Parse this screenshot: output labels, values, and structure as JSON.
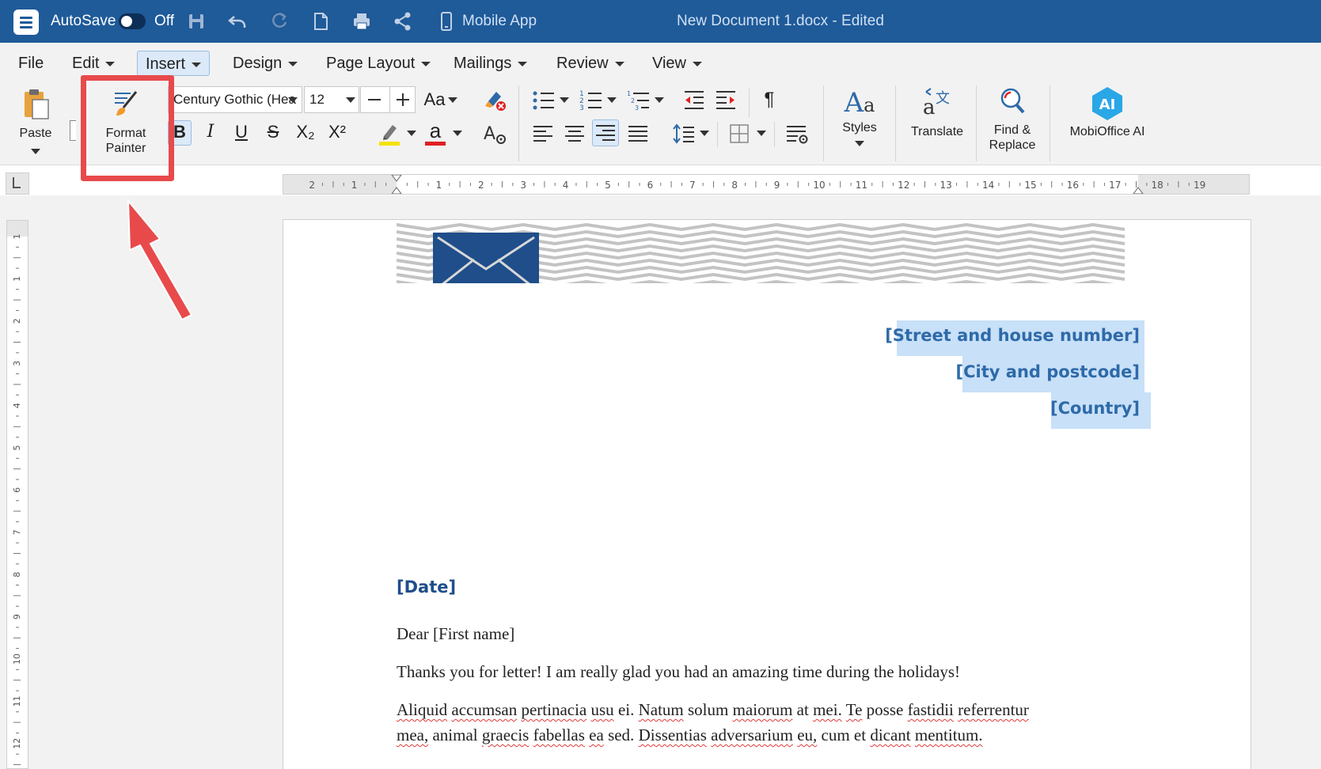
{
  "titlebar": {
    "autosave_label": "AutoSave",
    "autosave_state": "Off",
    "mobile_app_label": "Mobile App",
    "document_title": "New Document 1.docx - Edited"
  },
  "menu": {
    "items": [
      {
        "label": "File",
        "has_caret": false
      },
      {
        "label": "Edit",
        "has_caret": true
      },
      {
        "label": "Insert",
        "has_caret": true,
        "active": true
      },
      {
        "label": "Design",
        "has_caret": true
      },
      {
        "label": "Page Layout",
        "has_caret": true
      },
      {
        "label": "Mailings",
        "has_caret": true
      },
      {
        "label": "Review",
        "has_caret": true
      },
      {
        "label": "View",
        "has_caret": true
      }
    ]
  },
  "ribbon": {
    "paste_label": "Paste",
    "format_painter_line1": "Format",
    "format_painter_line2": "Painter",
    "font_name": "Century Gothic (Hea",
    "font_size": "12",
    "change_case_label": "Aa",
    "bold": "B",
    "italic": "I",
    "underline": "U",
    "strike": "S",
    "subscript": "X₂",
    "superscript": "X²",
    "font_color_letter": "a",
    "styles_label": "Styles",
    "translate_label": "Translate",
    "find_replace_line1": "Find &",
    "find_replace_line2": "Replace",
    "ai_label": "MobiOffice AI",
    "ai_badge": "AI",
    "pilcrow": "¶",
    "highlight_color": "#f5e100",
    "font_color": "#e02020"
  },
  "ruler": {
    "h_labels": [
      "2",
      "1",
      "1",
      "2",
      "3",
      "4",
      "5",
      "6",
      "7",
      "8",
      "9",
      "10",
      "11",
      "12",
      "13",
      "14",
      "15",
      "16",
      "17",
      "18",
      "19"
    ],
    "v_labels": [
      "1",
      "1",
      "2",
      "3",
      "4",
      "5",
      "6",
      "7",
      "8",
      "9",
      "10",
      "11",
      "12"
    ]
  },
  "document": {
    "address": [
      "[Street and house number]",
      "[City and postcode]",
      "[Country]"
    ],
    "date": "[Date]",
    "greeting": "Dear [First name]",
    "line1": "Thanks you for letter! I am really glad you had an amazing time during the holidays!",
    "para_line1_words": [
      "Aliquid",
      "accumsan",
      "pertinacia",
      "usu",
      "ei.",
      "Natum",
      "solum",
      "maiorum",
      "at",
      "mei.",
      "Te",
      "posse",
      "fastidii",
      "referrentur"
    ],
    "para_line2_words": [
      "mea,",
      "animal",
      "graecis",
      "fabellas",
      "ea",
      "sed.",
      "Dissentias",
      "adversarium",
      "eu,",
      "cum",
      "et",
      "dicant",
      "mentitum."
    ],
    "misspelled": [
      "Aliquid",
      "accumsan",
      "pertinacia",
      "usu",
      "Natum",
      "maiorum",
      "mei.",
      "Te",
      "fastidii",
      "referrentur",
      "mea,",
      "graecis",
      "fabellas",
      "ea",
      "Dissentias",
      "adversarium",
      "eu,",
      "dicant",
      "mentitum."
    ]
  },
  "colors": {
    "titlebar_bg": "#1f5a99",
    "accent": "#2e6aa8",
    "highlight_frame": "#e84a4c",
    "selection": "#c8e0f8"
  }
}
